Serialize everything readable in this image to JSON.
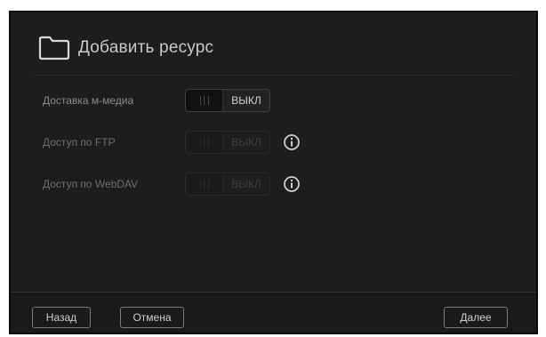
{
  "dialog": {
    "title": "Добавить ресурс",
    "icon": "folder-icon"
  },
  "settings": [
    {
      "label": "Доставка м-медиа",
      "toggle_state": "ВЫКЛ",
      "enabled": true,
      "info": false
    },
    {
      "label": "Доступ по FTP",
      "toggle_state": "ВЫКЛ",
      "enabled": false,
      "info": true
    },
    {
      "label": "Доступ по WebDAV",
      "toggle_state": "ВЫКЛ",
      "enabled": false,
      "info": true
    }
  ],
  "footer": {
    "back_label": "Назад",
    "cancel_label": "Отмена",
    "next_label": "Далее"
  },
  "colors": {
    "background": "#1d1d1d",
    "text": "#c9c9c9",
    "button_border": "#7a7a7a"
  }
}
